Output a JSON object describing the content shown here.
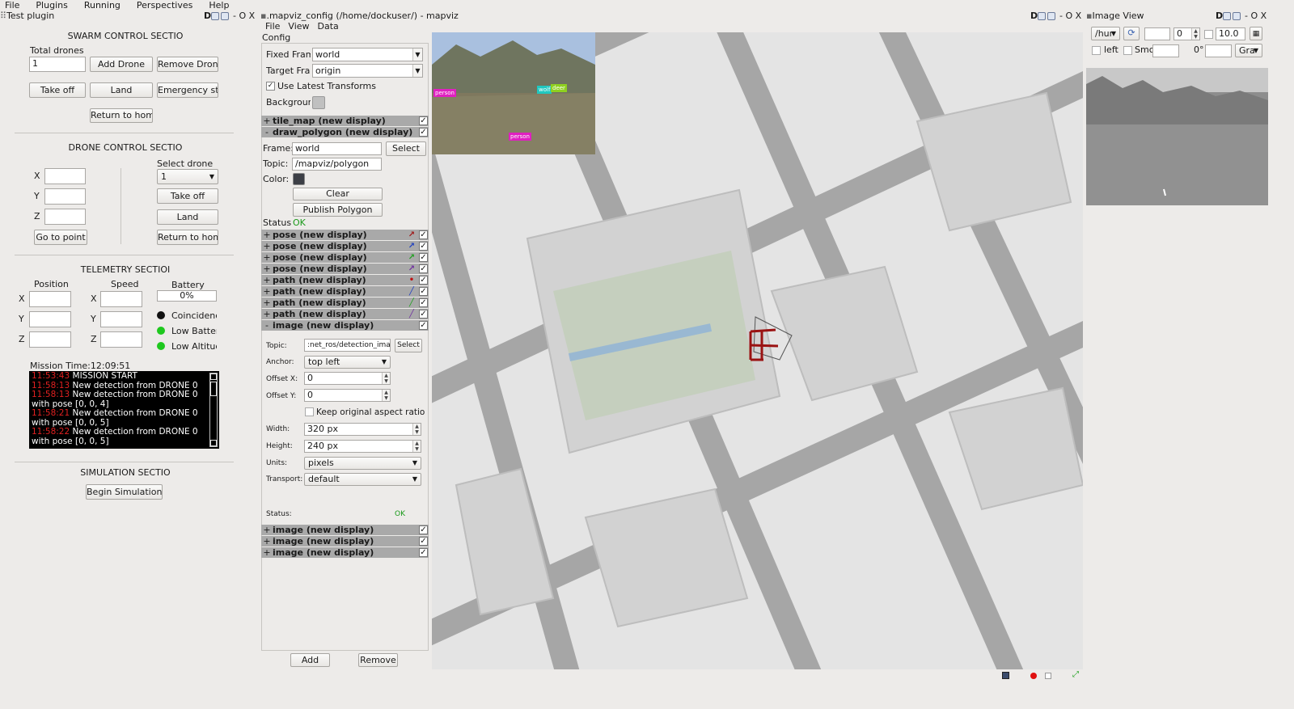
{
  "menubar": [
    "File",
    "Plugins",
    "Running",
    "Perspectives",
    "Help"
  ],
  "left": {
    "title": "Test plugin",
    "swarm": {
      "heading": "SWARM CONTROL SECTIO",
      "total_label": "Total drones",
      "total_value": "1",
      "add": "Add Drone",
      "remove": "Remove Drone",
      "takeoff": "Take off",
      "land": "Land",
      "emergency": "Emergency stop",
      "home": "Return to home"
    },
    "drone": {
      "heading": "DRONE CONTROL SECTIO",
      "x": "X",
      "y": "Y",
      "z": "Z",
      "goto": "Go to point",
      "select_label": "Select drone",
      "select_value": "1",
      "takeoff": "Take off",
      "land": "Land",
      "home": "Return to home"
    },
    "telemetry": {
      "heading": "TELEMETRY SECTIOI",
      "position": "Position",
      "speed": "Speed",
      "battery": "Battery",
      "battery_value": "0%",
      "x": "X",
      "y": "Y",
      "z": "Z",
      "coincidence": "Coincidenc",
      "low_battery": "Low Battery",
      "low_altitude": "Low Altitud",
      "mission_time": "Mission Time:12:09:51"
    },
    "log": [
      {
        "time": "11:53:43",
        "text": "MISSION START"
      },
      {
        "time": "11:58:13",
        "text": "New detection from DRONE 0"
      },
      {
        "time": "11:58:13",
        "text": "New detection from DRONE 0 with pose [0, 0, 4]"
      },
      {
        "time": "11:58:21",
        "text": "New detection from DRONE 0 with pose [0, 0, 5]"
      },
      {
        "time": "11:58:22",
        "text": "New detection from DRONE 0 with pose [0, 0, 5]"
      }
    ],
    "sim": {
      "heading": "SIMULATION SECTIO",
      "begin": "Begin Simulation"
    }
  },
  "mapviz": {
    "title": ".mapviz_config (/home/dockuser/) - mapviz",
    "menu": [
      "File",
      "View",
      "Data"
    ],
    "config": "Config",
    "fixed_label": "Fixed Fram",
    "fixed_value": "world",
    "target_label": "Target Fran",
    "target_value": "origin",
    "use_latest": "Use Latest Transforms",
    "background": "Backgrounc",
    "displays_top": [
      {
        "sign": "+",
        "name": "tile_map (new display)",
        "icon": ""
      },
      {
        "sign": "-",
        "name": "draw_polygon (new display)",
        "icon": ""
      }
    ],
    "polygon": {
      "frame_label": "Frame:",
      "frame_value": "world",
      "select": "Select",
      "topic_label": "Topic:",
      "topic_value": "/mapviz/polygon",
      "color_label": "Color:",
      "clear": "Clear",
      "publish": "Publish Polygon",
      "status_label": "Status:",
      "status_value": "OK"
    },
    "displays_mid": [
      {
        "sign": "+",
        "name": "pose (new display)",
        "color": "#a01818"
      },
      {
        "sign": "+",
        "name": "pose (new display)",
        "color": "#2040c0"
      },
      {
        "sign": "+",
        "name": "pose (new display)",
        "color": "#20a020"
      },
      {
        "sign": "+",
        "name": "pose (new display)",
        "color": "#7030a0"
      },
      {
        "sign": "+",
        "name": "path (new display)",
        "color": "#c01010"
      },
      {
        "sign": "+",
        "name": "path (new display)",
        "color": "#2040c0"
      },
      {
        "sign": "+",
        "name": "path (new display)",
        "color": "#20a020"
      },
      {
        "sign": "+",
        "name": "path (new display)",
        "color": "#7030a0"
      },
      {
        "sign": "-",
        "name": "image (new display)",
        "color": ""
      }
    ],
    "image": {
      "topic_label": "Topic:",
      "topic_value": ":net_ros/detection_image",
      "select": "Select",
      "anchor_label": "Anchor:",
      "anchor_value": "top left",
      "offx_label": "Offset X:",
      "offx_value": "0",
      "offy_label": "Offset Y:",
      "offy_value": "0",
      "keep": "Keep original aspect ratio",
      "width_label": "Width:",
      "width_value": "320 px",
      "height_label": "Height:",
      "height_value": "240 px",
      "units_label": "Units:",
      "units_value": "pixels",
      "transport_label": "Transport:",
      "transport_value": "default",
      "status_label": "Status:",
      "status_value": "OK"
    },
    "displays_bottom": [
      {
        "sign": "+",
        "name": "image (new display)"
      },
      {
        "sign": "+",
        "name": "image (new display)"
      },
      {
        "sign": "+",
        "name": "image (new display)"
      }
    ],
    "add": "Add",
    "remove": "Remove",
    "detections": [
      "person",
      "wolf",
      "deer",
      "person"
    ]
  },
  "imageview": {
    "title": "Image View",
    "topic": "/hur",
    "zoom1": "0",
    "zoom2": "10.0",
    "left": "left",
    "smooth": "Smc",
    "angle": "0°",
    "color": "Gra"
  },
  "window_controls": "- O X",
  "colors": {
    "ok": "#1a9a1a",
    "led_green": "#1ec81e",
    "led_black": "#111111",
    "log_time": "#e02020"
  }
}
